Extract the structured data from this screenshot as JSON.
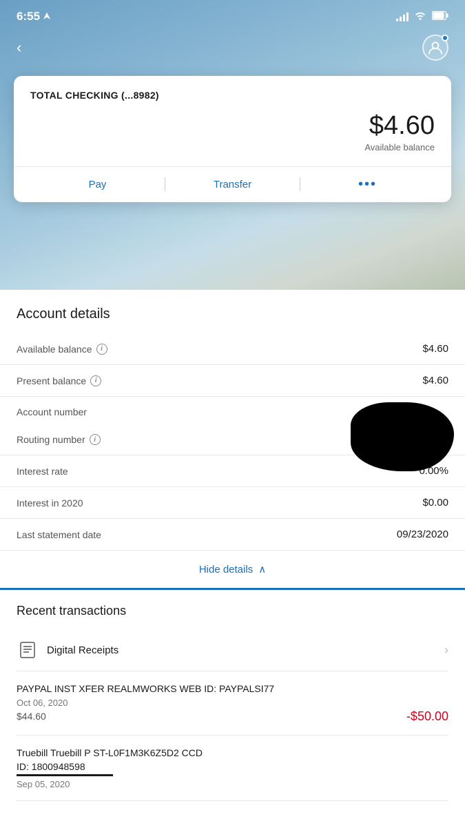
{
  "statusBar": {
    "time": "6:55",
    "timeIcon": "navigation-arrow",
    "signalBars": [
      4,
      7,
      10,
      13
    ],
    "batteryLevel": "80"
  },
  "header": {
    "backLabel": "‹",
    "profileAlt": "profile"
  },
  "accountCard": {
    "title": "TOTAL CHECKING (...8982)",
    "balance": "$4.60",
    "balanceLabel": "Available balance",
    "actions": {
      "pay": "Pay",
      "transfer": "Transfer",
      "more": "•••"
    }
  },
  "accountDetails": {
    "sectionTitle": "Account details",
    "rows": [
      {
        "label": "Available balance",
        "hasInfo": true,
        "value": "$4.60"
      },
      {
        "label": "Present balance",
        "hasInfo": true,
        "value": "$4.60"
      },
      {
        "label": "Account number",
        "hasInfo": false,
        "value": "REDACTED"
      },
      {
        "label": "Routing number",
        "hasInfo": true,
        "value": "REDACTED"
      },
      {
        "label": "Interest rate",
        "hasInfo": false,
        "value": "0.00%"
      },
      {
        "label": "Interest in 2020",
        "hasInfo": false,
        "value": "$0.00"
      },
      {
        "label": "Last statement date",
        "hasInfo": false,
        "value": "09/23/2020"
      }
    ],
    "hideDetails": "Hide details",
    "hideDetailsIcon": "∧"
  },
  "transactions": {
    "sectionTitle": "Recent transactions",
    "digitalReceipts": "Digital Receipts",
    "items": [
      {
        "title": "PAYPAL INST XFER REALMWORKS WEB ID: PAYPALSI77",
        "date": "Oct 06, 2020",
        "baseAmount": "$44.60",
        "change": "-$50.00",
        "isNegative": true
      },
      {
        "title": "Truebill Truebill P ST-L0F1M3K6Z5D2 CCD",
        "subtitle": "ID: 1800948598",
        "date": "Sep 05, 2020",
        "baseAmount": "",
        "change": "",
        "isNegative": false,
        "hasUnderline": true
      }
    ]
  }
}
